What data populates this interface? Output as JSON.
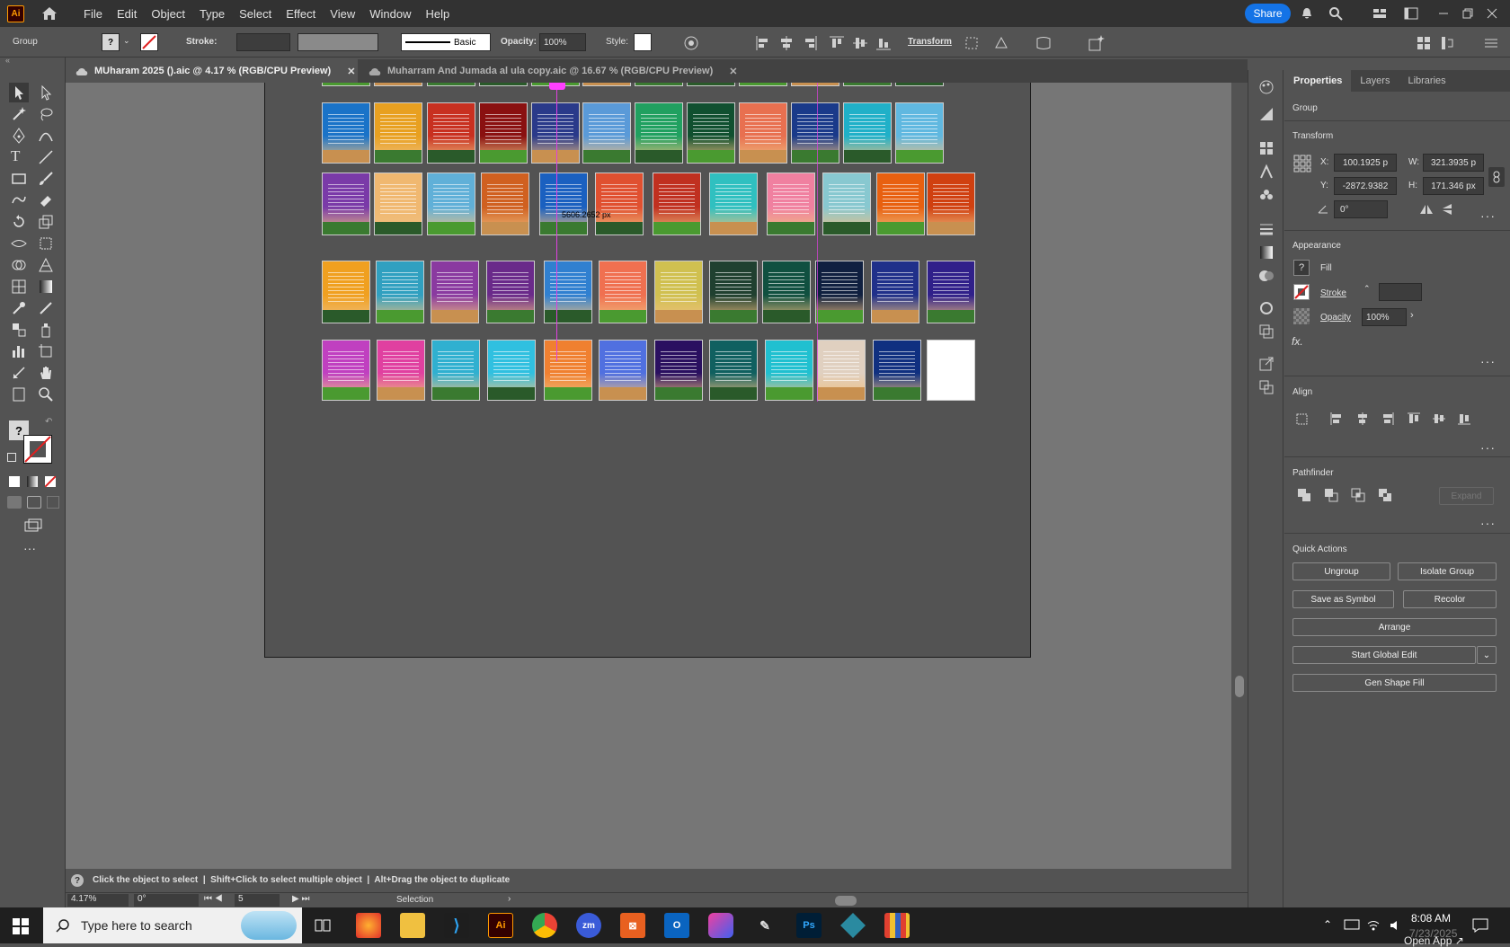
{
  "app": {
    "logo": "Ai"
  },
  "menu": [
    "File",
    "Edit",
    "Object",
    "Type",
    "Select",
    "Effect",
    "View",
    "Window",
    "Help"
  ],
  "share_label": "Share",
  "control": {
    "selection_type": "Group",
    "fill_glyph": "?",
    "stroke_label": "Stroke:",
    "brush_label": "Basic",
    "opacity_label": "Opacity:",
    "opacity_value": "100%",
    "style_label": "Style:",
    "transform_label": "Transform"
  },
  "tabs": [
    {
      "label": "MUharam 2025 ().aic @ 4.17 % (RGB/CPU Preview)",
      "active": true
    },
    {
      "label": "Muharram And Jumada al ula copy.aic @ 16.67 % (RGB/CPU Preview)",
      "active": false
    }
  ],
  "canvas": {
    "measure_label": "5606.2652 px"
  },
  "posters": {
    "row_b": [
      "#1a73c8",
      "#e8a020",
      "#c83020",
      "#8a1010",
      "#2a3a8a",
      "#5a9ad8",
      "#20a060",
      "#105030",
      "#e87050",
      "#1a3a8a",
      "#20b0c8",
      "#60b8e0"
    ],
    "row_c": [
      "#7a3aa8",
      "#f0b870",
      "#60b0d8",
      "#d06020",
      "#1a60c0",
      "#e05030",
      "#c03020",
      "#30c0c0",
      "#f080a0",
      "#88c8d0",
      "#e86010",
      "#d04010"
    ],
    "row_d": [
      "#f0a020",
      "#30a0c0",
      "#8a3aa0",
      "#6a2a8a",
      "#3080d0",
      "#f07050",
      "#d0c050",
      "#204030",
      "#105040",
      "#102040",
      "#20308a",
      "#30208a"
    ],
    "row_e": [
      "#c040c0",
      "#e040a0",
      "#30b0d0",
      "#30c0e0",
      "#f08030",
      "#5070e0",
      "#2a1060",
      "#106060",
      "#20c0d0",
      "#e0d0c0",
      "#103080",
      "#ffffff"
    ],
    "row_a": [
      "#a0c040",
      "#d08030",
      "#604020",
      "#303030",
      "#a03030",
      "#e0a070",
      "#d05050",
      "#c060a0",
      "#e0a040",
      "#3070b0",
      "#2a8a60",
      "#50a0d0"
    ]
  },
  "right_panel": {
    "tabs": [
      "Properties",
      "Layers",
      "Libraries"
    ],
    "selection": "Group",
    "transform_title": "Transform",
    "x_label": "X:",
    "x_value": "100.1925 p",
    "y_label": "Y:",
    "y_value": "-2872.9382",
    "w_label": "W:",
    "w_value": "321.3935 p",
    "h_label": "H:",
    "h_value": "171.346 px",
    "angle_value": "0°",
    "appearance_title": "Appearance",
    "fill_label": "Fill",
    "stroke_label": "Stroke",
    "opacity_label": "Opacity",
    "opacity_value": "100%",
    "fx_label": "fx.",
    "align_title": "Align",
    "pathfinder_title": "Pathfinder",
    "expand_label": "Expand",
    "quick_actions_title": "Quick Actions",
    "buttons": {
      "ungroup": "Ungroup",
      "isolate_group": "Isolate Group",
      "save_symbol": "Save as Symbol",
      "recolor": "Recolor",
      "arrange": "Arrange",
      "start_global_edit": "Start Global Edit",
      "gen_shape_fill": "Gen Shape Fill"
    }
  },
  "status": {
    "hint": "Click the object to select  |  Shift+Click to select multiple object  |  Alt+Drag the object to duplicate",
    "zoom": "4.17%",
    "rotation": "0°",
    "artboard_num": "5",
    "tool_name": "Selection"
  },
  "taskbar": {
    "search_placeholder": "Type here to search",
    "time": "8:08 AM",
    "date": "7/23/2025",
    "tooltip": "Open App ↗"
  }
}
